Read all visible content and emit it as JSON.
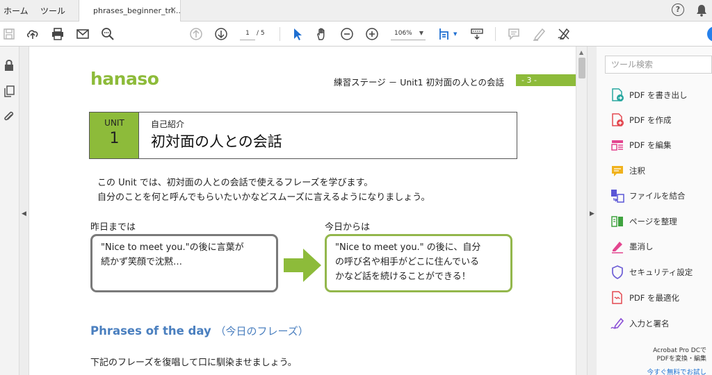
{
  "tabbar": {
    "home_label": "ホーム",
    "tools_label": "ツール",
    "document_tab": "phrases_beginner_tri...",
    "close_glyph": "×",
    "help_glyph": "?",
    "icons": [
      "help-icon",
      "bell-icon"
    ]
  },
  "toolbar": {
    "current_page": "1",
    "total_pages": "/ 5",
    "zoom": "106%",
    "icons": [
      "save-icon",
      "upload-icon",
      "print-icon",
      "email-icon",
      "zoom-search-icon",
      "page-up-icon",
      "page-down-icon",
      "select-arrow-icon",
      "hand-icon",
      "zoom-out-icon",
      "zoom-in-icon",
      "fit-page-icon",
      "scroll-mode-icon",
      "comment-icon",
      "highlight-icon",
      "sign-icon"
    ]
  },
  "left_rail": {
    "icons": [
      "lock-icon",
      "copy-pages-icon",
      "attachment-icon"
    ]
  },
  "document": {
    "logo": "hanaso",
    "header_title": "練習ステージ － Unit1 初対面の人との会話",
    "page_number": "- 3 -",
    "unit_label": "UNIT",
    "unit_number": "1",
    "unit_subtitle": "自己紹介",
    "unit_title": "初対面の人との会話",
    "intro_line1": "この Unit では、初対面の人との会話で使えるフレーズを学びます。",
    "intro_line2": "自分のことを何と呼んでもらいたいかなどスムーズに言えるようになりましょう。",
    "before_heading": "昨日までは",
    "after_heading": "今日からは",
    "before_line1": "\"Nice to meet you.\"の後に言葉が",
    "before_line2": "続かず笑顔で沈黙…",
    "after_line1": "\"Nice to meet you.\" の後に、自分",
    "after_line2": "の呼び名や相手がどこに住んでいる",
    "after_line3": "かなど話を続けることができる！",
    "phrases_en": "Phrases of the day",
    "phrases_jp": "（今日のフレーズ）",
    "instruction": "下記のフレーズを復唱して口に馴染ませましょう。"
  },
  "tools_panel": {
    "search_placeholder": "ツール検索",
    "items": [
      {
        "label": "PDF を書き出し",
        "icon": "export-pdf-icon",
        "color": "#28a7a0"
      },
      {
        "label": "PDF を作成",
        "icon": "create-pdf-icon",
        "color": "#e34850"
      },
      {
        "label": "PDF を編集",
        "icon": "edit-pdf-icon",
        "color": "#e3458f"
      },
      {
        "label": "注釈",
        "icon": "comment-icon",
        "color": "#f0b21d"
      },
      {
        "label": "ファイルを結合",
        "icon": "combine-files-icon",
        "color": "#5a56d6"
      },
      {
        "label": "ページを整理",
        "icon": "organize-pages-icon",
        "color": "#3fa33f"
      },
      {
        "label": "墨消し",
        "icon": "redact-icon",
        "color": "#e3458f"
      },
      {
        "label": "セキュリティ設定",
        "icon": "shield-icon",
        "color": "#6e5fd6"
      },
      {
        "label": "PDF を最適化",
        "icon": "optimize-pdf-icon",
        "color": "#e34850"
      },
      {
        "label": "入力と署名",
        "icon": "fill-sign-icon",
        "color": "#8a4fd6"
      }
    ],
    "promo_line1": "Acrobat Pro DCで",
    "promo_line2": "PDFを変換・編集",
    "promo_link": "今すぐ無料でお試し"
  },
  "colors": {
    "accent_green": "#8dbb3a",
    "heading_blue": "#4a7fbf",
    "bubble_gray": "#7a7a7a",
    "bubble_green": "#93b74c"
  }
}
